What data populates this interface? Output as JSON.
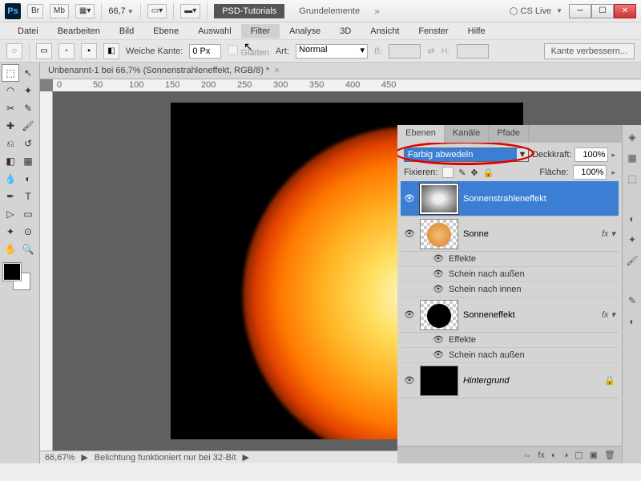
{
  "titlebar": {
    "app": "Ps",
    "br": "Br",
    "mb": "Mb",
    "zoom": "66,7",
    "psd_tab": "PSD-Tutorials",
    "grund_tab": "Grundelemente",
    "cslive": "CS Live"
  },
  "menu": [
    "Datei",
    "Bearbeiten",
    "Bild",
    "Ebene",
    "Auswahl",
    "Filter",
    "Analyse",
    "3D",
    "Ansicht",
    "Fenster",
    "Hilfe"
  ],
  "menu_active_index": 5,
  "optbar": {
    "weiche": "Weiche Kante:",
    "weiche_val": "0 Px",
    "glaetten": "Glätten",
    "art": "Art:",
    "art_val": "Normal",
    "b": "B:",
    "h": "H:",
    "kante": "Kante verbessern..."
  },
  "doc": {
    "tab": "Unbenannt-1 bei 66,7% (Sonnenstrahleneffekt, RGB/8) *",
    "ruler_marks": [
      "0",
      "50",
      "100",
      "150",
      "200",
      "250",
      "300",
      "350",
      "400",
      "450"
    ]
  },
  "status": {
    "zoom": "66,67%",
    "msg": "Belichtung funktioniert nur bei 32-Bit"
  },
  "panels": {
    "tabs": [
      "Ebenen",
      "Kanäle",
      "Pfade"
    ],
    "active_tab": 0,
    "blend_mode": "Farbig abwedeln",
    "opacity_lbl": "Deckkraft:",
    "opacity": "100%",
    "fix_lbl": "Fixieren:",
    "fill_lbl": "Fläche:",
    "fill": "100%",
    "layers": [
      {
        "name": "Sonnenstrahleneffekt",
        "selected": true,
        "thumb": "clouds"
      },
      {
        "name": "Sonne",
        "fx": true,
        "thumb": "sun",
        "sub": [
          "Effekte",
          "Schein nach außen",
          "Schein nach innen"
        ]
      },
      {
        "name": "Sonneneffekt",
        "fx": true,
        "thumb": "blackcircle",
        "sub": [
          "Effekte",
          "Schein nach außen"
        ]
      },
      {
        "name": "Hintergrund",
        "locked": true,
        "thumb": "black",
        "italic": true
      }
    ]
  }
}
